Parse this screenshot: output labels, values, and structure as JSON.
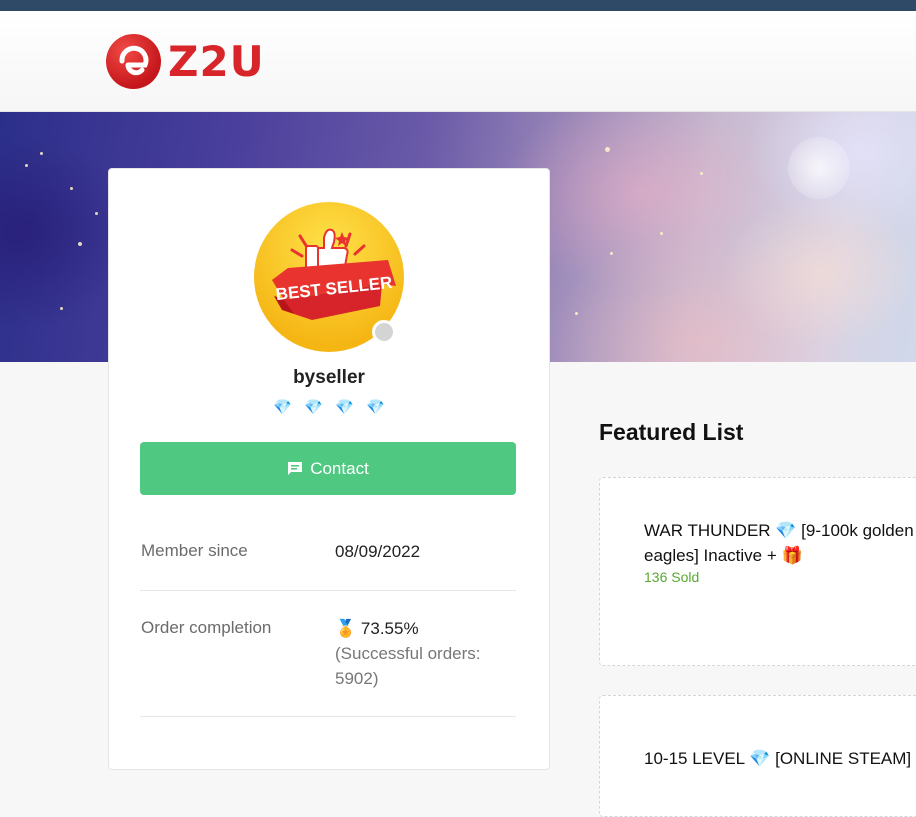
{
  "header": {
    "logo_text": "Z2U"
  },
  "seller": {
    "avatar_text": "BEST SELLER",
    "username": "byseller",
    "gems": [
      "💎",
      "💎",
      "💎",
      "💎"
    ],
    "contact_label": "Contact",
    "member_since_label": "Member since",
    "member_since_value": "08/09/2022",
    "order_completion_label": "Order completion",
    "order_completion_icon": "🏅",
    "order_completion_value": "73.55%",
    "successful_orders_text": "(Successful orders: 5902)"
  },
  "featured": {
    "title": "Featured List",
    "items": [
      {
        "title": "WAR THUNDER 💎 [9-100k golden eagles] Inactive + 🎁",
        "sold": "136 Sold"
      },
      {
        "title": "10-15 LEVEL 💎 [ONLINE STEAM]",
        "sold": ""
      }
    ]
  },
  "colors": {
    "accent_green": "#4fc882",
    "brand_red": "#d8252a",
    "sold_green": "#5aa832"
  }
}
